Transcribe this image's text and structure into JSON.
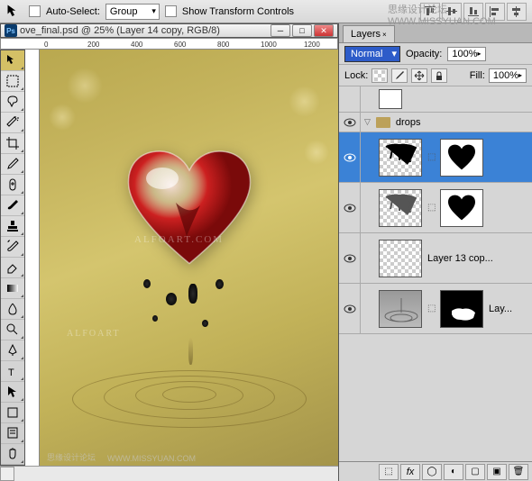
{
  "optionsBar": {
    "autoSelectLabel": "Auto-Select:",
    "groupValue": "Group",
    "showTransformLabel": "Show Transform Controls"
  },
  "watermarkSite": "WWW.MISSYUAN.COM",
  "watermarkDesign": "思缘设计论坛",
  "document": {
    "title": "ove_final.psd @ 25% (Layer 14 copy, RGB/8)",
    "rulerMarks": [
      "0",
      "200",
      "400",
      "600",
      "800",
      "1000",
      "1200"
    ]
  },
  "canvasWatermarks": {
    "center": "ALFOART.COM",
    "left": "ALFOART",
    "bottomDesign": "思缘设计论坛",
    "bottomSite": "WWW.MISSYUAN.COM"
  },
  "layersPanel": {
    "tabLabel": "Layers",
    "blendMode": "Normal",
    "opacityLabel": "Opacity:",
    "opacityValue": "100%",
    "lockLabel": "Lock:",
    "fillLabel": "Fill:",
    "fillValue": "100%",
    "groupName": "drops",
    "layer13": "Layer 13 cop...",
    "layerLay": "Lay..."
  }
}
